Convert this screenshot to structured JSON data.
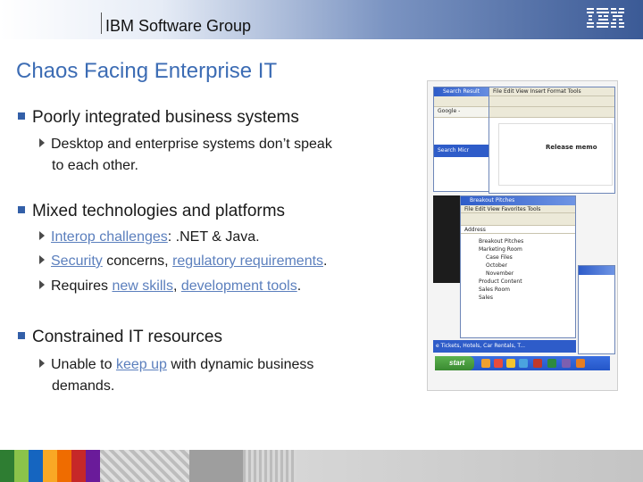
{
  "header": {
    "group": "IBM Software Group",
    "logo": "IBM"
  },
  "title": "Chaos Facing Enterprise IT",
  "bullets": [
    {
      "label": "Poorly integrated business systems",
      "subs": [
        {
          "line1": "Desktop and enterprise systems don’t speak",
          "line2": "to each other."
        }
      ]
    },
    {
      "label": "Mixed technologies and platforms",
      "subs": [
        {
          "link1": "Interop challenges",
          "rest": ": .NET & Java."
        },
        {
          "link1": "Security",
          "mid": " concerns, ",
          "link2": "regulatory requirements",
          "end": "."
        },
        {
          "pre": "Requires ",
          "link1": "new skills",
          "mid": ", ",
          "link2": "development tools",
          "end": "."
        }
      ]
    },
    {
      "label": "Constrained IT resources",
      "subs": [
        {
          "pre": "Unable to ",
          "link1": "keep up",
          "rest": " with dynamic business",
          "line2": "demands."
        }
      ]
    }
  ],
  "collage": {
    "win1_title": "Search Result",
    "menu": "File Edit View Insert Format Tools",
    "google": "Google -",
    "doc_text": "Release memo",
    "search": "Search Micr",
    "win2_title": "Breakout Pitches",
    "win2_menu": "File Edit View Favorites Tools",
    "address": "Address",
    "folders": [
      "Breakout Pitches",
      "Marketing Room",
      "Case Files",
      "October",
      "November",
      "Product Content",
      "Sales Room",
      "Sales"
    ],
    "status": "e Tickets, Hotels, Car Rentals, T...",
    "start": "start"
  },
  "colors": {
    "title": "#3c6cb4",
    "bullet": "#335fa8",
    "link": "#5b7fbd"
  }
}
